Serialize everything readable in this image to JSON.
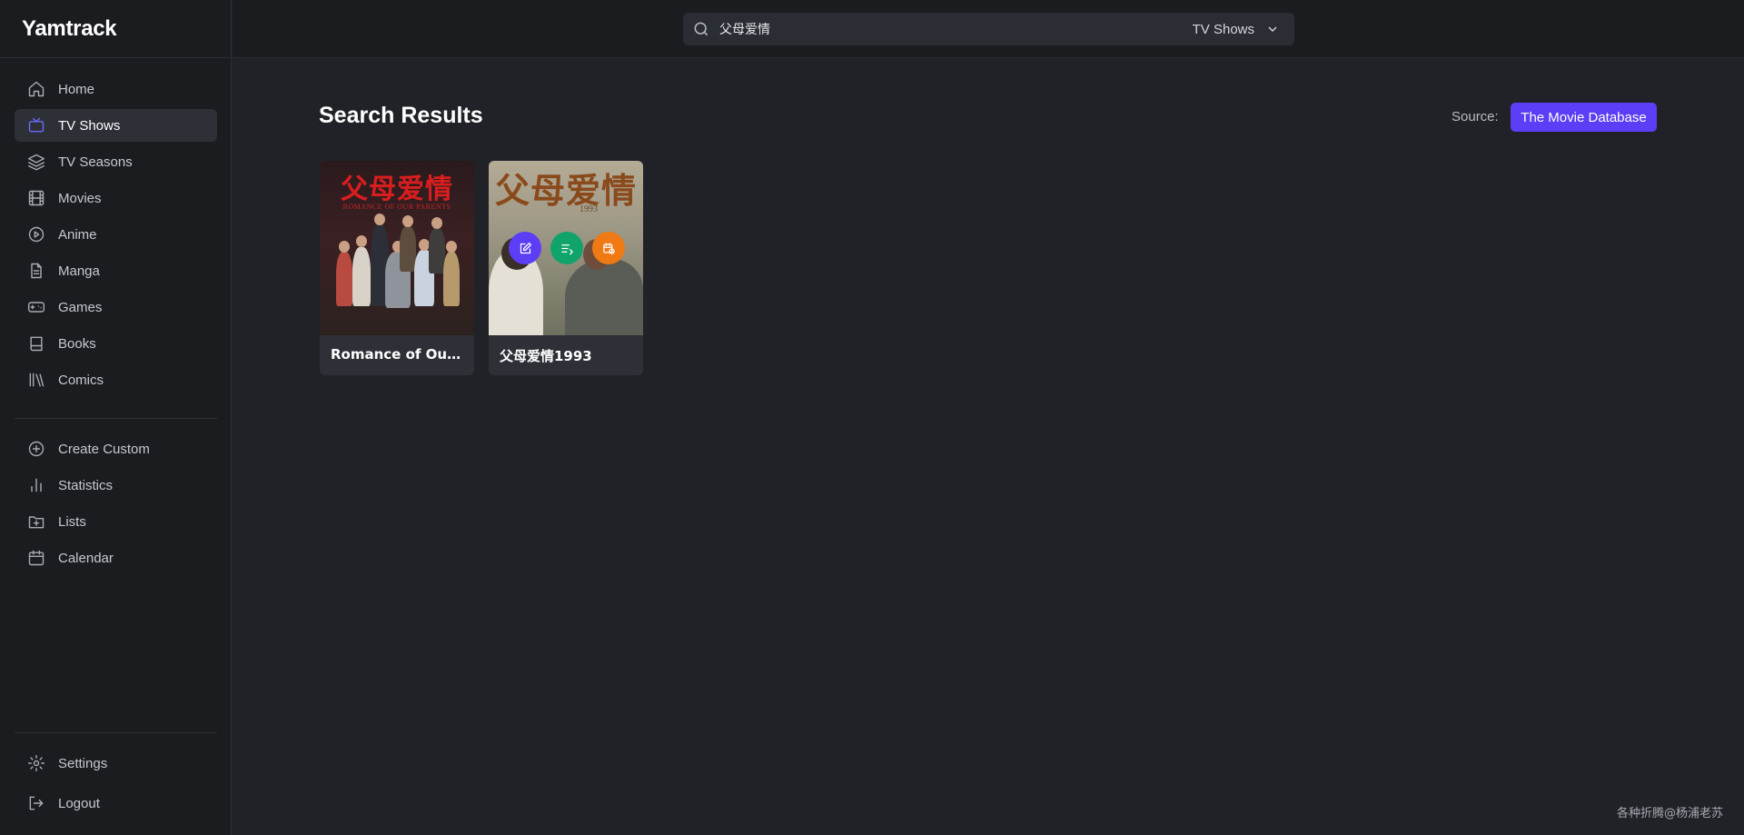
{
  "app": {
    "title": "Yamtrack"
  },
  "sidebar": {
    "items": [
      {
        "label": "Home",
        "icon": "home-icon",
        "active": false
      },
      {
        "label": "TV Shows",
        "icon": "tv-icon",
        "active": true
      },
      {
        "label": "TV Seasons",
        "icon": "layers-icon",
        "active": false
      },
      {
        "label": "Movies",
        "icon": "film-icon",
        "active": false
      },
      {
        "label": "Anime",
        "icon": "play-circle-icon",
        "active": false
      },
      {
        "label": "Manga",
        "icon": "file-text-icon",
        "active": false
      },
      {
        "label": "Games",
        "icon": "gamepad-icon",
        "active": false
      },
      {
        "label": "Books",
        "icon": "book-icon",
        "active": false
      },
      {
        "label": "Comics",
        "icon": "library-icon",
        "active": false
      }
    ],
    "tools": [
      {
        "label": "Create Custom",
        "icon": "plus-circle-icon"
      },
      {
        "label": "Statistics",
        "icon": "bar-chart-icon"
      },
      {
        "label": "Lists",
        "icon": "folder-plus-icon"
      },
      {
        "label": "Calendar",
        "icon": "calendar-icon"
      }
    ],
    "bottom": [
      {
        "label": "Settings",
        "icon": "gear-icon"
      },
      {
        "label": "Logout",
        "icon": "logout-icon"
      }
    ]
  },
  "search": {
    "value": "父母爱情",
    "type": "TV Shows"
  },
  "main": {
    "title": "Search Results",
    "source_label": "Source:",
    "source_value": "The Movie Database"
  },
  "results": [
    {
      "title": "Romance of Our Parents",
      "display": "Romance of Our...",
      "poster_title": "父母爱情",
      "poster_subtitle": "ROMANCE OF OUR PARENTS"
    },
    {
      "title": "父母爱情1993",
      "display": "父母爱情1993",
      "poster_title": "父母爱情",
      "poster_subtitle": "1993"
    }
  ],
  "overlay_actions": [
    "edit",
    "add-to-list",
    "track-schedule"
  ],
  "colors": {
    "accent": "#5b3ef5",
    "green": "#10a36a",
    "orange": "#ef7a14",
    "background": "#202227",
    "sidebar": "#1a1c20"
  },
  "watermark": "各种折腾@杨浦老苏"
}
